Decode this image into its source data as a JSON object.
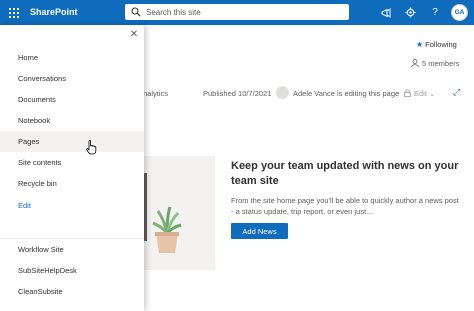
{
  "suitebar": {
    "app_name": "SharePoint",
    "search_placeholder": "Search this site",
    "avatar_initials": "GA",
    "icons": [
      "waffle-icon",
      "search-icon",
      "megaphone-icon",
      "gear-icon",
      "help-icon"
    ]
  },
  "header": {
    "following_label": "Following",
    "members_label": "5 members"
  },
  "infobar": {
    "analytics_label": "nalytics",
    "published_label": "Published 10/7/2021",
    "editing_label": "Adele Vance is editing this page",
    "edit_label": "Edit"
  },
  "news": {
    "title": "Keep your team updated with news on your team site",
    "body": "From the site home page you'll be able to quickly author a news post - a status update, trip report, or even just...",
    "add_button": "Add News"
  },
  "nav": {
    "top_items": [
      {
        "label": "Home"
      },
      {
        "label": "Conversations"
      },
      {
        "label": "Documents"
      },
      {
        "label": "Notebook"
      },
      {
        "label": "Pages"
      },
      {
        "label": "Site contents"
      },
      {
        "label": "Recycle bin"
      },
      {
        "label": "Edit"
      }
    ],
    "bottom_items": [
      {
        "label": "Workflow Site"
      },
      {
        "label": "SubSiteHelpDesk"
      },
      {
        "label": "CleanSubsite"
      }
    ]
  },
  "colors": {
    "brand": "#0f6cbd",
    "hover_bg": "#f3f2f1"
  }
}
